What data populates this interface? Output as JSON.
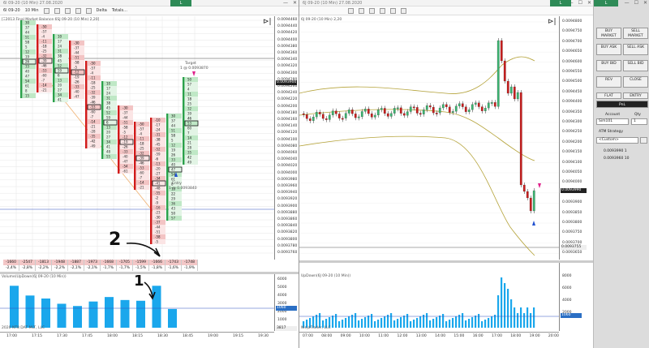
{
  "left_window": {
    "title": "6l 09-20 (10 Min) 27.08.2020",
    "toolbar": {
      "instrument": "6l 09-20",
      "interval": "10 Min",
      "delta": "Delta",
      "totals": "Totals..."
    },
    "indicator_label": "[Ξ2013 Final Market Balance  6SJ 09-20 (10 Min) 2,20]",
    "target_label": "Target",
    "target_value": "1 @ 0.0093870",
    "entry_label": "Entry",
    "entry_value": "1 @ 0.0093840",
    "price_ticks": [
      "0.0094460",
      "0.0094440",
      "0.0094420",
      "0.0094400",
      "0.0094380",
      "0.0094360",
      "0.0094340",
      "0.0094320",
      "0.0094300",
      "0.0094280",
      "0.0094260",
      "0.0094240",
      "0.0094220",
      "0.0094200",
      "0.0094180",
      "0.0094160",
      "0.0094140",
      "0.0094120",
      "0.0094100",
      "0.0094080",
      "0.0094060",
      "0.0094040",
      "0.0094020",
      "0.0094000",
      "0.0093980",
      "0.0093960",
      "0.0093940",
      "0.0093920",
      "0.0093900",
      "0.0093880",
      "0.0093860",
      "0.0093840",
      "0.0093820",
      "0.0093800",
      "0.0093780",
      "0.0093760"
    ],
    "current_price": "0.0093900",
    "delta_values": [
      "-1660",
      "-2547",
      "-1813",
      "-1948",
      "-1887",
      "-1973",
      "-1668",
      "-1705",
      "-1599",
      "-1666",
      "-1743",
      "-1748"
    ],
    "delta_pcts": [
      "-2,4%",
      "-2,8%",
      "-2,2%",
      "-2,2%",
      "-2,1%",
      "-2,1%",
      "-1,7%",
      "-1,7%",
      "-1,5%",
      "-1,8%",
      "-1,6%",
      "-1,9%"
    ],
    "volume_label": "Volume(UpDown(6J 09-20 (10 Min))",
    "volume_ticks": [
      "6000",
      "5000",
      "4000",
      "3000",
      "2000",
      "1000"
    ],
    "volume_current": "1060",
    "volume_last": "3817",
    "time_labels": [
      "17:00",
      "17:15",
      "17:30",
      "17:45",
      "18:00",
      "18:15",
      "18:30",
      "18:45",
      "19:00",
      "19:15",
      "19:30"
    ],
    "copyright": "2020 NT8 DAT MLT, LLC",
    "volume_bars": [
      5600,
      4300,
      3900,
      3200,
      2900,
      3500,
      4100,
      3700,
      3600,
      5600,
      2500
    ],
    "annotations": {
      "one": "1",
      "two": "2"
    },
    "colors": {
      "bull": "#2aa14a",
      "bear": "#d11a1a",
      "vol": "#1aa7ec",
      "grid": "#e6e6e6"
    }
  },
  "right_window": {
    "title": "6J 09-20 (10 Min) 27.08.2020",
    "chart_label": "6J 09-20 (10 Min) 2,20",
    "price_ticks": [
      "0.0094800",
      "0.0094750",
      "0.0094700",
      "0.0094650",
      "0.0094600",
      "0.0094550",
      "0.0094500",
      "0.0094450",
      "0.0094400",
      "0.0094350",
      "0.0094300",
      "0.0094250",
      "0.0094200",
      "0.0094150",
      "0.0094100",
      "0.0094050",
      "0.0094000",
      "0.0093950",
      "0.0093900",
      "0.0093850",
      "0.0093800",
      "0.0093750",
      "0.0093700",
      "0.0093650"
    ],
    "current_price": "0.0093990",
    "low_price": "0.0093755",
    "volume_label": "UpDown(6J 09-20 (10 Min))",
    "volume_ticks": [
      "8000",
      "6000",
      "4000",
      "2000"
    ],
    "volume_current": "1060",
    "time_labels": [
      "07:00",
      "08:00",
      "09:00",
      "10:00",
      "11:00",
      "12:00",
      "13:00",
      "14:00",
      "15:00",
      "16:00",
      "17:00",
      "18:00",
      "19:00",
      "20:00"
    ],
    "copyright": "NinjaTrader, LLC"
  },
  "order_panel": {
    "buttons": [
      {
        "label": "BUY\nMARKET",
        "key": "buy-market"
      },
      {
        "label": "SELL\nMARKET",
        "key": "sell-market"
      },
      {
        "label": "BUY ASK",
        "key": "buy-ask"
      },
      {
        "label": "SELL ASK",
        "key": "sell-ask"
      },
      {
        "label": "BUY BID",
        "key": "buy-bid"
      },
      {
        "label": "SELL BID",
        "key": "sell-bid"
      },
      {
        "label": "REV",
        "key": "rev"
      },
      {
        "label": "CLOSE",
        "key": "close"
      }
    ],
    "flat": "FLAT",
    "entry": "ENTRY",
    "pnl": "PnL",
    "account_label": "Account",
    "qty_label": "Qty",
    "account_value": "Sim101",
    "qty_value": "1",
    "atm_label": "ATM Strategy",
    "atm_value": "<Custom>",
    "order_lines": [
      "0.0093990 1",
      "0.0093960 10"
    ]
  }
}
